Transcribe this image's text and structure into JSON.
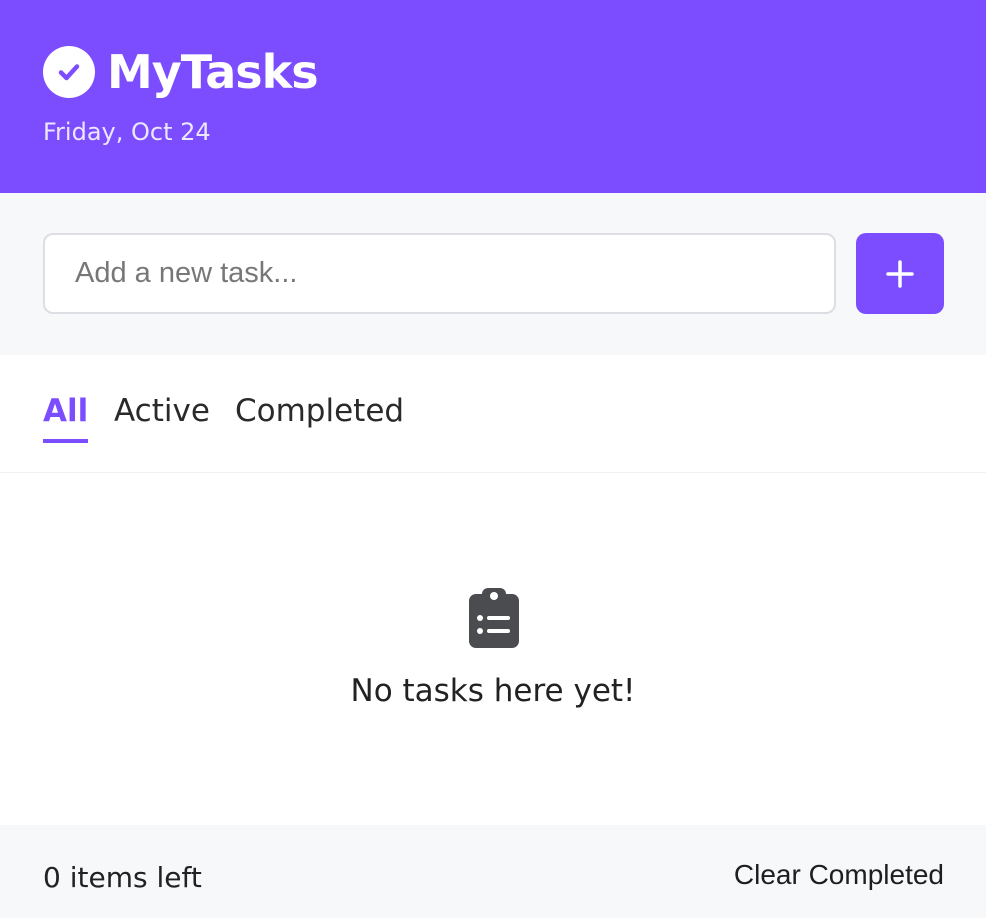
{
  "header": {
    "title": "MyTasks",
    "date": "Friday, Oct 24",
    "logo_icon": "check-circle-icon"
  },
  "input": {
    "placeholder": "Add a new task...",
    "value": "",
    "add_icon": "plus-icon"
  },
  "tabs": [
    {
      "label": "All",
      "active": true
    },
    {
      "label": "Active",
      "active": false
    },
    {
      "label": "Completed",
      "active": false
    }
  ],
  "empty_state": {
    "icon": "clipboard-list-icon",
    "message": "No tasks here yet!"
  },
  "footer": {
    "items_left": "0 items left",
    "clear_label": "Clear Completed"
  },
  "colors": {
    "accent": "#7c4dff",
    "header_bg": "#7c4dff",
    "panel_bg": "#f7f8fa",
    "icon_dark": "#4a4c50"
  }
}
